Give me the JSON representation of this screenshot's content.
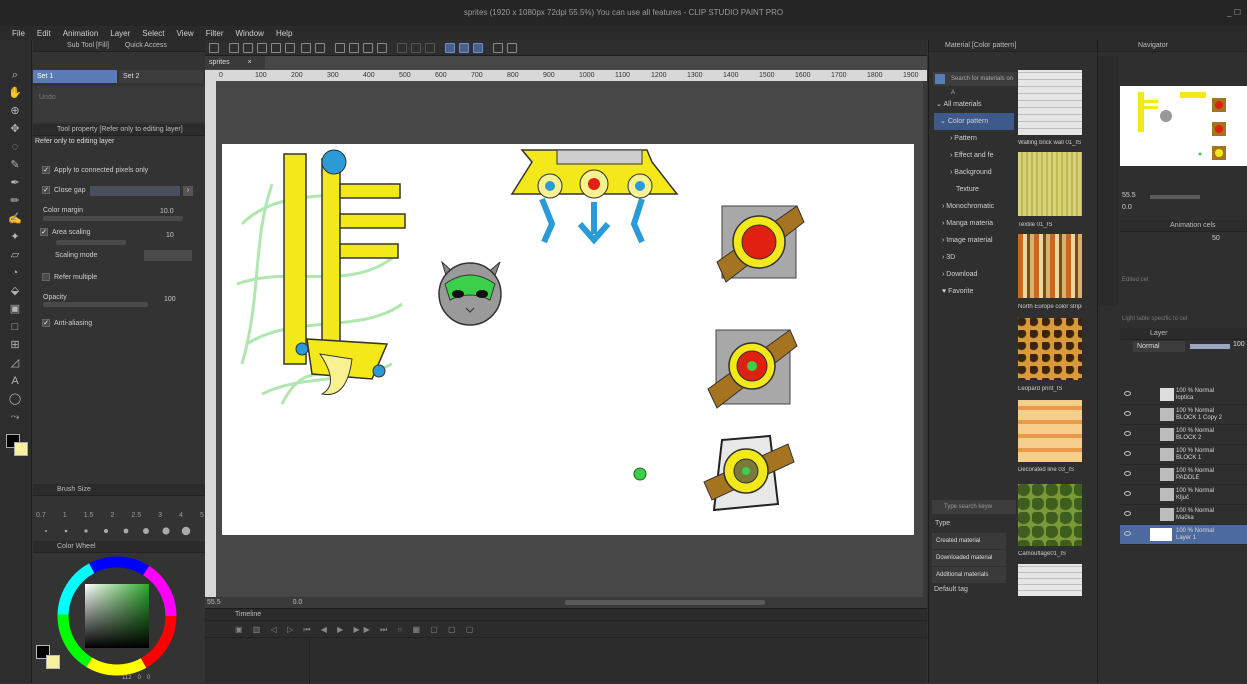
{
  "window_title": "sprites (1920 x 1080px 72dpi 55.5%)  You can use all features - CLIP STUDIO PAINT PRO",
  "menu": [
    "File",
    "Edit",
    "Animation",
    "Layer",
    "Select",
    "View",
    "Filter",
    "Window",
    "Help"
  ],
  "left_panel": {
    "tab1": "Sub Tool [Fill]",
    "tab2": "Quick Access",
    "set1": "Set 1",
    "set2": "Set 2",
    "undo": "Undo",
    "tool_property_header": "Tool property [Refer only to editing layer]",
    "tool_name": "Refer only to editing layer",
    "apply_connected": "Apply to connected pixels only",
    "close_gap": "Close gap",
    "color_margin_label": "Color margin",
    "color_margin_value": "10.0",
    "area_scaling_label": "Area scaling",
    "area_scaling_value": "10",
    "scaling_mode": "Scaling mode",
    "refer_multiple": "Refer multiple",
    "opacity_label": "Opacity",
    "opacity_value": "100",
    "anti_aliasing": "Anti-aliasing",
    "brush_size_header": "Brush Size",
    "brush_sizes": [
      "0.7",
      "1",
      "1.5",
      "2",
      "2.5",
      "3",
      "4",
      "5"
    ],
    "color_wheel_header": "Color Wheel",
    "hsv": [
      "112",
      "0",
      "0"
    ]
  },
  "canvas": {
    "doc_tab": "sprites",
    "ruler_ticks": [
      "0",
      "100",
      "200",
      "300",
      "400",
      "500",
      "600",
      "700",
      "800",
      "900",
      "1000",
      "1100",
      "1200",
      "1300",
      "1400",
      "1500",
      "1600",
      "1700",
      "1800",
      "1900"
    ],
    "zoom": "55.5",
    "angle": "0.0"
  },
  "timeline": {
    "header": "Timeline"
  },
  "material": {
    "header": "Material [Color pattern]",
    "search_placeholder": "Search for materials on A",
    "tree": [
      "All materials",
      "Color pattern",
      "Pattern",
      "Effect and fe",
      "Background",
      "Texture",
      "Monochromatic",
      "Manga materia",
      "Image material",
      "3D",
      "Download",
      "Favorite"
    ],
    "thumbs": [
      "Walling brick wall 01_IS",
      "Textile 01_IS",
      "North Europe color stripe",
      "Leopard print_IS",
      "Decorated line 03_IS",
      "Camouflage01_IS"
    ],
    "search_keyword_placeholder": "Type search keyw",
    "type_label": "Type",
    "types": [
      "Created material",
      "Downloaded material",
      "Additional materials"
    ],
    "default_tag": "Default tag"
  },
  "right_panel": {
    "navigator_header": "Navigator",
    "nav_zoom": "55.5",
    "nav_angle": "0.0",
    "animation_cels_header": "Animation cels",
    "anim_value": "50",
    "edited_cel": "Edited cel",
    "light_table": "Light table specific to cel",
    "layer_header": "Layer",
    "blend_mode": "Normal",
    "layer_opacity": "100",
    "layers": [
      {
        "pct": "100 % Normal",
        "name": "loptica"
      },
      {
        "pct": "100 % Normal",
        "name": "BLOCK 1 Copy 2"
      },
      {
        "pct": "100 % Normal",
        "name": "BLOCK 2"
      },
      {
        "pct": "100 % Normal",
        "name": "BLOCK 1"
      },
      {
        "pct": "100 % Normal",
        "name": "PADDLE"
      },
      {
        "pct": "100 % Normal",
        "name": "Ključ"
      },
      {
        "pct": "100 % Normal",
        "name": "Mačka"
      },
      {
        "pct": "100 % Normal",
        "name": "Layer 1"
      }
    ]
  },
  "colors": {
    "accent": "#5a7bb5",
    "sprite_yellow": "#f2e81a",
    "sprite_blue": "#2a9bd6",
    "block_brown": "#a57420",
    "block_red": "#e02010"
  }
}
